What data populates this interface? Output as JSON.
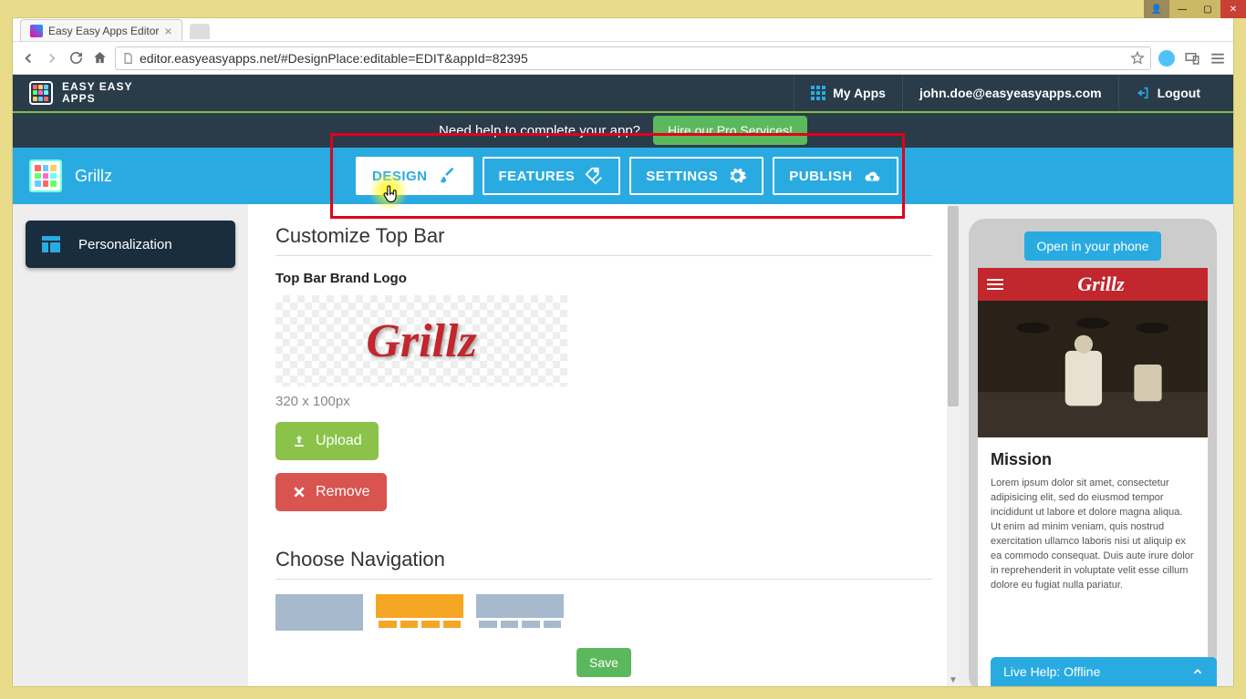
{
  "window": {
    "title": "Easy Easy Apps Editor"
  },
  "browser": {
    "url": "editor.easyeasyapps.net/#DesignPlace:editable=EDIT&appId=82395"
  },
  "header": {
    "brand_line1": "EASY EASY",
    "brand_line2": "APPS",
    "my_apps": "My Apps",
    "user_email": "john.doe@easyeasyapps.com",
    "logout": "Logout"
  },
  "help_banner": {
    "text": "Need help to complete your app?",
    "button": "Hire our Pro Services!"
  },
  "app_toolbar": {
    "app_name": "Grillz",
    "tabs": {
      "design": "DESIGN",
      "features": "FEATURES",
      "settings": "SETTINGS",
      "publish": "PUBLISH"
    }
  },
  "sidebar": {
    "personalization": "Personalization"
  },
  "main": {
    "section1_title": "Customize Top Bar",
    "logo_label": "Top Bar Brand Logo",
    "logo_text": "Grillz",
    "logo_dims": "320 x 100px",
    "upload_btn": "Upload",
    "remove_btn": "Remove",
    "section2_title": "Choose Navigation",
    "save_btn": "Save"
  },
  "preview": {
    "open_phone": "Open in your phone",
    "topbar_logo": "Grillz",
    "mission_title": "Mission",
    "mission_text": "Lorem ipsum dolor sit amet, consectetur adipisicing elit, sed do eiusmod tempor incididunt ut labore et dolore magna aliqua. Ut enim ad minim veniam, quis nostrud exercitation ullamco laboris nisi ut aliquip ex ea commodo consequat. Duis aute irure dolor in reprehenderit in voluptate velit esse cillum dolore eu fugiat nulla pariatur."
  },
  "live_help": "Live Help: Offline"
}
